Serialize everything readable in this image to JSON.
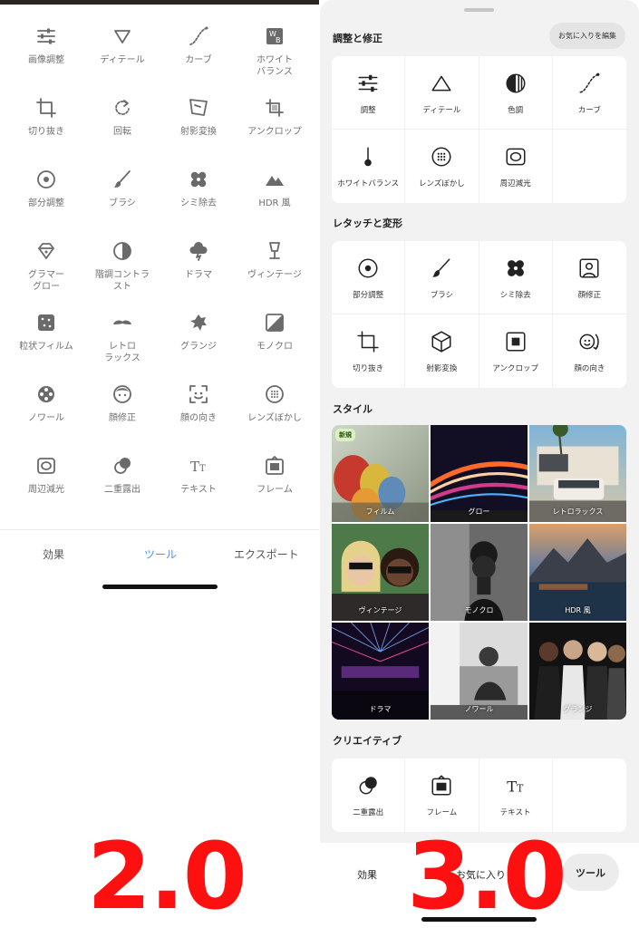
{
  "left_panel": {
    "tools": [
      {
        "label": "画像調整",
        "icon": "sliders-icon"
      },
      {
        "label": "ディテール",
        "icon": "triangle-down-icon"
      },
      {
        "label": "カーブ",
        "icon": "curve-icon"
      },
      {
        "label": "ホワイト\nバランス",
        "icon": "white-balance-icon"
      },
      {
        "label": "切り抜き",
        "icon": "crop-icon"
      },
      {
        "label": "回転",
        "icon": "rotate-icon"
      },
      {
        "label": "射影変換",
        "icon": "perspective-icon"
      },
      {
        "label": "アンクロップ",
        "icon": "expand-icon"
      },
      {
        "label": "部分調整",
        "icon": "target-icon"
      },
      {
        "label": "ブラシ",
        "icon": "brush-icon"
      },
      {
        "label": "シミ除去",
        "icon": "bandage-icon"
      },
      {
        "label": "HDR 風",
        "icon": "mountain-icon"
      },
      {
        "label": "グラマー\nグロー",
        "icon": "diamond-icon"
      },
      {
        "label": "階調コントラ\nスト",
        "icon": "contrast-icon"
      },
      {
        "label": "ドラマ",
        "icon": "cloud-icon"
      },
      {
        "label": "ヴィンテージ",
        "icon": "lamp-icon"
      },
      {
        "label": "粒状フィルム",
        "icon": "grain-icon"
      },
      {
        "label": "レトロ\nラックス",
        "icon": "mustache-icon"
      },
      {
        "label": "グランジ",
        "icon": "grunge-icon"
      },
      {
        "label": "モノクロ",
        "icon": "mono-icon"
      },
      {
        "label": "ノワール",
        "icon": "film-reel-icon"
      },
      {
        "label": "顔修正",
        "icon": "face-icon"
      },
      {
        "label": "顔の向き",
        "icon": "face-frame-icon"
      },
      {
        "label": "レンズぼかし",
        "icon": "dots-circle-icon"
      },
      {
        "label": "周辺減光",
        "icon": "vignette-icon"
      },
      {
        "label": "二重露出",
        "icon": "double-exposure-icon"
      },
      {
        "label": "テキスト",
        "icon": "text-icon"
      },
      {
        "label": "フレーム",
        "icon": "frame-icon"
      }
    ],
    "tabs": [
      "効果",
      "ツール",
      "エクスポート"
    ],
    "active_tab": "ツール",
    "version_label": "2.0",
    "accent_color": "#4a8df6"
  },
  "right_panel": {
    "sections": {
      "adjust_title": "調整と修正",
      "favorites_button": "お気に入りを編集",
      "retouch_title": "レタッチと変形",
      "style_title": "スタイル",
      "creative_title": "クリエイティブ"
    },
    "adjust_tools": [
      {
        "label": "調整",
        "icon": "sliders-icon"
      },
      {
        "label": "ディテール",
        "icon": "triangle-icon"
      },
      {
        "label": "色調",
        "icon": "color-tone-icon"
      },
      {
        "label": "カーブ",
        "icon": "curve-icon"
      },
      {
        "label": "ホワイトバランス",
        "icon": "thermometer-icon"
      },
      {
        "label": "レンズぼかし",
        "icon": "dots-circle-icon"
      },
      {
        "label": "周辺減光",
        "icon": "vignette-icon"
      }
    ],
    "retouch_tools": [
      {
        "label": "部分調整",
        "icon": "target-icon"
      },
      {
        "label": "ブラシ",
        "icon": "brush-icon"
      },
      {
        "label": "シミ除去",
        "icon": "bandage-icon"
      },
      {
        "label": "顔修正",
        "icon": "portrait-icon"
      },
      {
        "label": "切り抜き",
        "icon": "crop-icon"
      },
      {
        "label": "射影変換",
        "icon": "cube-icon"
      },
      {
        "label": "アンクロップ",
        "icon": "uncrop-icon"
      },
      {
        "label": "顔の向き",
        "icon": "face-rotate-icon"
      }
    ],
    "styles": [
      {
        "label": "フィルム",
        "badge": "新規"
      },
      {
        "label": "グロー"
      },
      {
        "label": "レトロラックス"
      },
      {
        "label": "ヴィンテージ"
      },
      {
        "label": "モノクロ"
      },
      {
        "label": "HDR 風"
      },
      {
        "label": "ドラマ"
      },
      {
        "label": "ノワール"
      },
      {
        "label": "グランジ"
      }
    ],
    "creative_tools": [
      {
        "label": "二重露出",
        "icon": "double-exposure-icon"
      },
      {
        "label": "フレーム",
        "icon": "frame-icon"
      },
      {
        "label": "テキスト",
        "icon": "text-icon"
      }
    ],
    "bottom_tabs": {
      "effects": "効果",
      "favorites": "お気に入り",
      "tools": "ツール"
    },
    "version_label": "3.0"
  },
  "colors": {
    "version_red": "#ff1010",
    "new_badge_bg": "#d9f2c0"
  }
}
